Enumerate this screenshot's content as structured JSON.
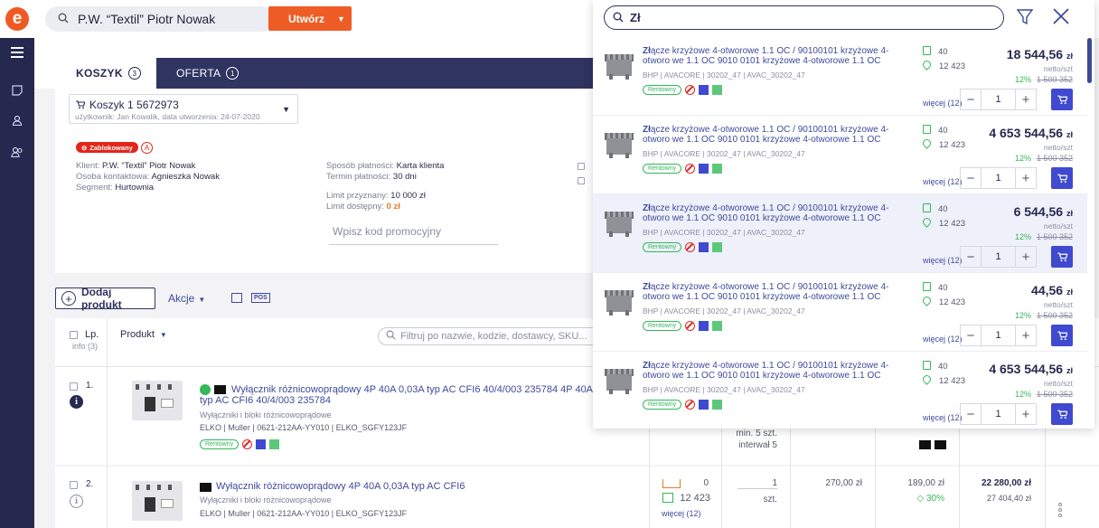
{
  "app": {
    "logo_letter": "e"
  },
  "header": {
    "search_value": "P.W. “Textil” Piotr Nowak",
    "create_label": "Utwórz"
  },
  "tabs": [
    {
      "label": "KOSZYK",
      "count": "3"
    },
    {
      "label": "OFERTA",
      "count": "1"
    }
  ],
  "cart": {
    "title": "Koszyk 1 5672973",
    "subtitle": "użytkownik: Jan Kowalik, data utworzenia: 24-07-2020",
    "blocked_label": "Zablokowany",
    "a_badge": "A",
    "client_label": "Klient:",
    "client": "P.W. “Textil” Piotr Nowak",
    "contact_label": "Osoba kontaktowa:",
    "contact": "Agnieszka Nowak",
    "segment_label": "Segment:",
    "segment": "Hurtownia",
    "payment_label": "Sposób płatności:",
    "payment": "Karta klienta",
    "term_label": "Termin płatności:",
    "term": "30 dni",
    "limit_label": "Limit przyznany:",
    "limit": "10 000 zł",
    "avail_label": "Limit dostępny:",
    "avail": "0 zł",
    "promo_placeholder": "Wpisz kod promocyjny"
  },
  "toolbar": {
    "add_label": "Dodaj produkt",
    "actions_label": "Akcje",
    "pos_label": "POS"
  },
  "table": {
    "lp_header": "Lp.",
    "info_header": "info (3)",
    "product_header": "Produkt",
    "filter_placeholder": "Filtruj po nazwie, kodzie, dostawcy, SKU...",
    "rows": [
      {
        "num": "1.",
        "name": "Wyłącznik różnicowoprądowy 4P 40A 0,03A typ AC CFI6 40/4/003 235784 4P 40A",
        "name2": "typ AC CFI6 40/4/003 235784",
        "category": "Wyłączniki i bloki różnicowoprądowe",
        "codes": "ELKO | Muller | 0621-212AA-YY010 | ELKO_SGFY123JF",
        "tag": "Rentowny",
        "min_qty": "min. 5 szt.",
        "interval": "interwał 5"
      },
      {
        "num": "2.",
        "name": "Wyłącznik różnicowoprądowy 4P 40A 0,03A typ AC CFI6",
        "category": "Wyłączniki i bloki różnicowoprądowe",
        "codes": "ELKO | Muller | 0621-212AA-YY010 | ELKO_SGFY123JF",
        "stock_a": "0",
        "stock_b": "12 423",
        "more": "więcej (12)",
        "qty": "1",
        "unit": "szt.",
        "price_list": "270,00 zł",
        "price_net": "189,00 zł",
        "discount": "30%",
        "total": "22 280,00 zł",
        "total_gross": "27 404,40 zł"
      }
    ]
  },
  "dropdown": {
    "query": "Zł",
    "results": [
      {
        "title_bold": "Zł",
        "title_rest": "ącze krzyżowe 4-otworowe 1.1 OC / 90100101 krzyżowe 4-otworo we 1.1 OC 9010 0101 krzyżowe 4-otworowe 1.1 OC",
        "codes": "BHP | AVACORE | 30202_47 | AVAC_30202_47",
        "tag": "Rentowny",
        "stock": "40",
        "stock2": "12 423",
        "more": "więcej (12)",
        "price": "18 544,56",
        "currency": "zł",
        "netto": "netto/szt",
        "disc": "12%",
        "old": "1 500 352",
        "qty": "1"
      },
      {
        "title_bold": "Zł",
        "title_rest": "ącze krzyżowe 4-otworowe 1.1 OC / 90100101 krzyżowe 4-otworo we 1.1 OC 9010 0101 krzyżowe 4-otworowe 1.1 OC",
        "codes": "BHP | AVACORE | 30202_47 | AVAC_30202_47",
        "tag": "Rentowny",
        "stock": "40",
        "stock2": "12 423",
        "more": "więcej (12)",
        "price": "4 653 544,56",
        "currency": "zł",
        "netto": "netto/szt",
        "disc": "12%",
        "old": "1 500 352",
        "qty": "1"
      },
      {
        "title_bold": "Zł",
        "title_rest": "ącze krzyżowe 4-otworowe 1.1 OC / 90100101 krzyżowe 4-otworo we 1.1 OC 9010 0101 krzyżowe 4-otworowe 1.1 OC",
        "codes": "BHP | AVACORE | 30202_47 | AVAC_30202_47",
        "tag": "Rentowny",
        "stock": "40",
        "stock2": "12 423",
        "more": "więcej (12)",
        "price": "6 544,56",
        "currency": "zł",
        "netto": "netto/szt",
        "disc": "12%",
        "old": "1 500 352",
        "qty": "1"
      },
      {
        "title_bold": "Zł",
        "title_rest": "ącze krzyżowe 4-otworowe 1.1 OC / 90100101 krzyżowe 4-otworo we 1.1 OC 9010 0101 krzyżowe 4-otworowe 1.1 OC",
        "codes": "BHP | AVACORE | 30202_47 | AVAC_30202_47",
        "tag": "Rentowny",
        "stock": "40",
        "stock2": "12 423",
        "more": "więcej (12)",
        "price": "44,56",
        "currency": "zł",
        "netto": "netto/szt",
        "disc": "12%",
        "old": "1 500 352",
        "qty": "1"
      },
      {
        "title_bold": "Zł",
        "title_rest": "ącze krzyżowe 4-otworowe 1.1 OC / 90100101 krzyżowe 4-otworo we 1.1 OC 9010 0101 krzyżowe 4-otworowe 1.1 OC",
        "codes": "BHP | AVACORE | 30202_47 | AVAC_30202_47",
        "tag": "Rentowny",
        "stock": "40",
        "stock2": "12 423",
        "more": "więcej (12)",
        "price": "4 653 544,56",
        "currency": "zł",
        "netto": "netto/szt",
        "disc": "12%",
        "old": "1 500 352",
        "qty": "1"
      }
    ]
  },
  "colors": {
    "brand": "#ee5d25",
    "navy": "#26294f",
    "accent_blue": "#3f4ad0",
    "green": "#33b85a",
    "red": "#e1261c"
  }
}
